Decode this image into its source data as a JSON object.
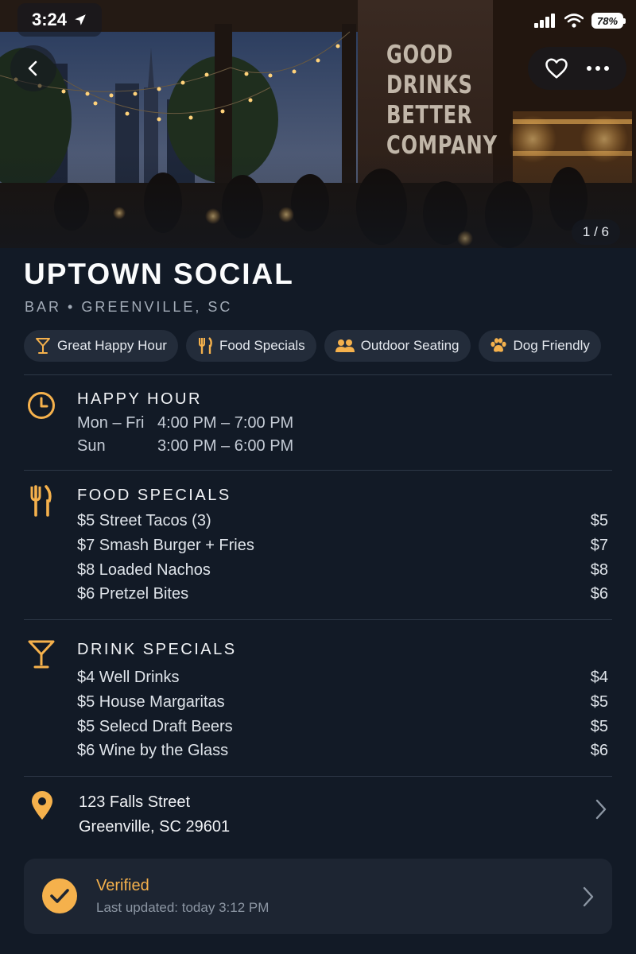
{
  "status_bar": {
    "time": "3:24",
    "battery": "78%"
  },
  "hero": {
    "wall_sign": [
      "GOOD",
      "DRINKS",
      "BETTER",
      "COMPANY"
    ],
    "photo_counter": "1 / 6"
  },
  "venue": {
    "name": "UPTOWN SOCIAL",
    "subtitle": "BAR • GREENVILLE, SC"
  },
  "tags": [
    {
      "label": "Great Happy Hour",
      "icon": "martini-icon"
    },
    {
      "label": "Food Specials",
      "icon": "utensils-icon"
    },
    {
      "label": "Outdoor Seating",
      "icon": "people-icon"
    },
    {
      "label": "Dog Friendly",
      "icon": "paw-icon"
    }
  ],
  "happy_hour": {
    "title": "HAPPY HOUR",
    "rows": [
      {
        "days": "Mon – Fri",
        "hours": "4:00 PM – 7:00 PM"
      },
      {
        "days": "Sun",
        "hours": "3:00 PM – 6:00 PM"
      }
    ]
  },
  "food_specials": {
    "title": "FOOD SPECIALS",
    "items": [
      {
        "name": "$5 Street Tacos (3)",
        "price": "$5"
      },
      {
        "name": "$7 Smash Burger + Fries",
        "price": "$7"
      },
      {
        "name": "$8 Loaded Nachos",
        "price": "$8"
      },
      {
        "name": "$6 Pretzel Bites",
        "price": "$6"
      }
    ]
  },
  "drink_specials": {
    "title": "DRINK SPECIALS",
    "items": [
      {
        "name": "$4 Well Drinks",
        "price": "$4"
      },
      {
        "name": "$5 House Margaritas",
        "price": "$5"
      },
      {
        "name": "$5 Selecd Draft Beers",
        "price": "$5"
      },
      {
        "name": "$6 Wine by the Glass",
        "price": "$6"
      }
    ]
  },
  "address": {
    "line1": "123 Falls Street",
    "line2": "Greenville, SC 29601"
  },
  "verified": {
    "title": "Verified",
    "updated": "Last updated: today 3:12 PM"
  },
  "colors": {
    "accent": "#f5b14c",
    "background": "#121a26",
    "card": "#1d2532",
    "chip": "#232c3a"
  }
}
